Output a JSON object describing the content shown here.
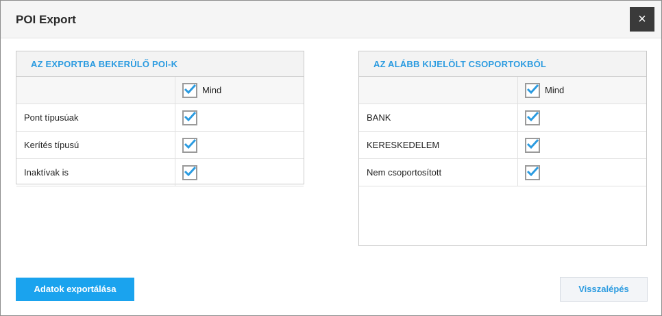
{
  "dialog": {
    "title": "POI Export",
    "close_icon": "×"
  },
  "left_panel": {
    "title": "AZ EXPORTBA BEKERÜLŐ POI-K",
    "all_label": "Mind",
    "rows": [
      {
        "label": "Pont típusúak",
        "checked": true
      },
      {
        "label": "Kerítés típusú",
        "checked": true
      },
      {
        "label": "Inaktívak is",
        "checked": true
      }
    ]
  },
  "right_panel": {
    "title": "AZ ALÁBB KIJELÖLT CSOPORTOKBÓL",
    "all_label": "Mind",
    "rows": [
      {
        "label": "BANK",
        "checked": true
      },
      {
        "label": "KERESKEDELEM",
        "checked": true
      },
      {
        "label": "Nem csoportosított",
        "checked": true
      }
    ]
  },
  "buttons": {
    "export_label": "Adatok exportálása",
    "back_label": "Visszalépés"
  },
  "colors": {
    "accent": "#1aa3ee",
    "check": "#2b9be0"
  }
}
